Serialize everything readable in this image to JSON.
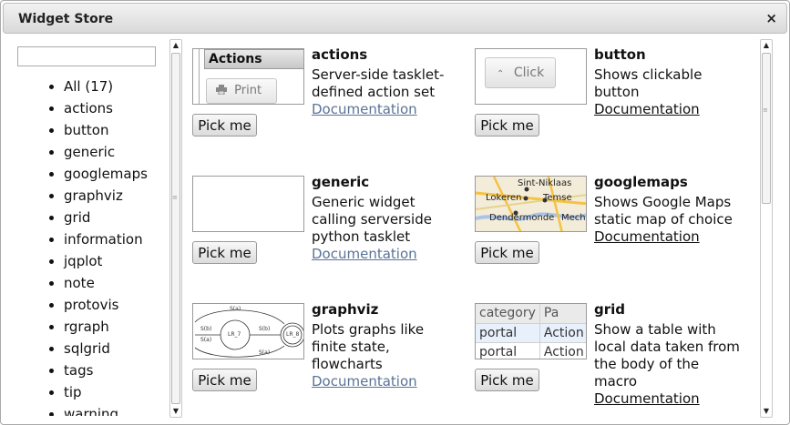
{
  "window": {
    "title": "Widget Store",
    "close_icon": "×"
  },
  "sidebar": {
    "search_placeholder": "",
    "categories": [
      "All (17)",
      "actions",
      "button",
      "generic",
      "googlemaps",
      "graphviz",
      "grid",
      "information",
      "jqplot",
      "note",
      "protovis",
      "rgraph",
      "sqlgrid",
      "tags",
      "tip",
      "warning"
    ]
  },
  "widgets": [
    {
      "name": "actions",
      "description": "Server-side tasklet-defined action set",
      "doc_label": "Documentation",
      "pick_label": "Pick me",
      "preview": {
        "header": "Actions",
        "button": "Print",
        "icon": "printer-icon"
      }
    },
    {
      "name": "button",
      "description": "Shows clickable button",
      "doc_label": "Documentation",
      "pick_label": "Pick me",
      "preview": {
        "button": "Click",
        "icon": "chevron-up-icon"
      }
    },
    {
      "name": "generic",
      "description": "Generic widget calling serverside python tasklet",
      "doc_label": "Documentation",
      "pick_label": "Pick me"
    },
    {
      "name": "googlemaps",
      "description": "Shows Google Maps static map of choice",
      "doc_label": "Documentation",
      "pick_label": "Pick me",
      "preview": {
        "places": [
          "Sint-Niklaas",
          "Lokeren",
          "Temse",
          "Dendermonde",
          "Mech"
        ]
      }
    },
    {
      "name": "graphviz",
      "description": "Plots graphs like finite state, flowcharts",
      "doc_label": "Documentation",
      "pick_label": "Pick me",
      "preview": {
        "nodes": [
          "LR_7",
          "LR_8"
        ],
        "edges": [
          "S(a)",
          "S(b)",
          "S(b)",
          "S(a)",
          "S(a)"
        ]
      }
    },
    {
      "name": "grid",
      "description": "Show a table with local data taken from the body of the macro",
      "doc_label": "Documentation",
      "pick_label": "Pick me",
      "preview": {
        "headers": [
          "category",
          "Pa"
        ],
        "rows": [
          [
            "portal",
            "Action"
          ],
          [
            "portal",
            "Action"
          ]
        ]
      }
    }
  ],
  "colors": {
    "doc_link_visited": "#5a7396",
    "doc_link": "#111111",
    "map_water": "#aac3e6",
    "map_land": "#f3ecd8",
    "map_road": "#f5c242"
  }
}
